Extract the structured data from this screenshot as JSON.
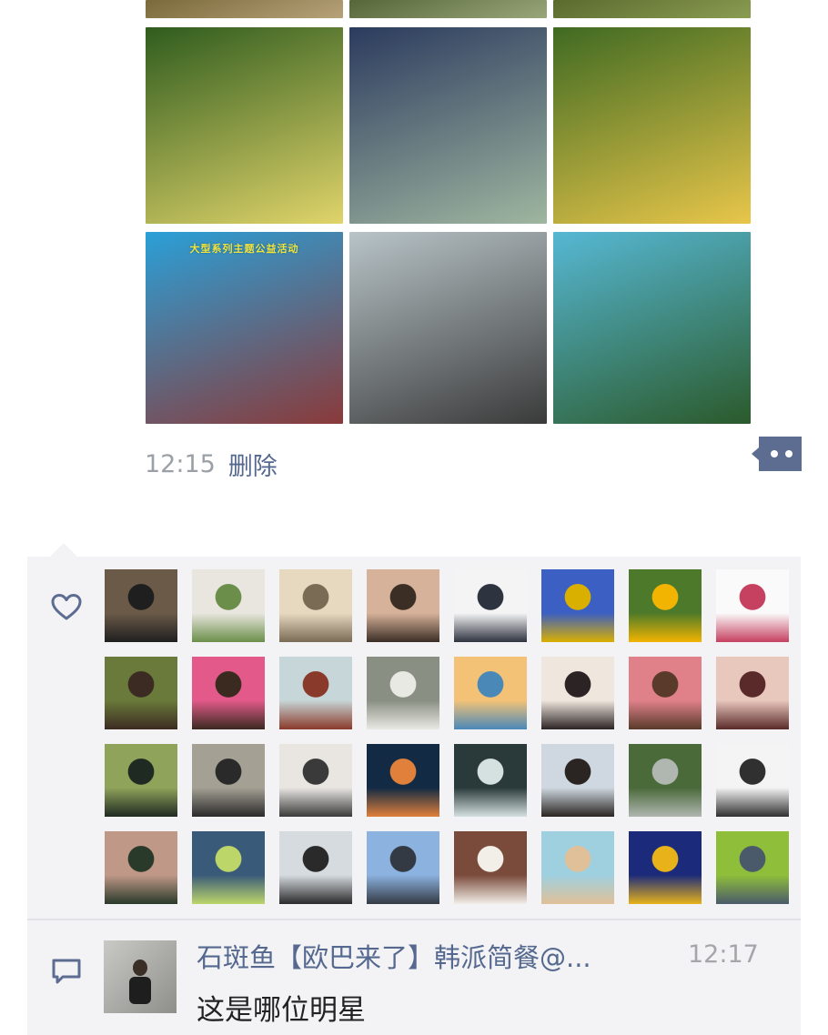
{
  "post": {
    "time": "12:15",
    "delete_label": "删除",
    "more_icon": "more-dots-icon",
    "photos": [
      {
        "name": "photo-top-1",
        "colors": [
          "#7a6a3a",
          "#b7a27a"
        ]
      },
      {
        "name": "photo-top-2",
        "colors": [
          "#556638",
          "#9aa67a"
        ]
      },
      {
        "name": "photo-top-3",
        "colors": [
          "#5a6a2e",
          "#8b9c52"
        ]
      },
      {
        "name": "photo-orchard-girl-fruit",
        "colors": [
          "#2f5c1e",
          "#e0d46a"
        ]
      },
      {
        "name": "photo-girl-blue-jacket",
        "colors": [
          "#2b3b5e",
          "#9fb6a0"
        ]
      },
      {
        "name": "photo-girl-picking-orange",
        "colors": [
          "#3f6a22",
          "#e8c64a"
        ]
      },
      {
        "name": "photo-event-stage",
        "caption": "大型系列主题公益活动",
        "colors": [
          "#2aa0d8",
          "#8a3a3a"
        ]
      },
      {
        "name": "photo-crowd",
        "colors": [
          "#b8c4c8",
          "#3a3a3a"
        ]
      },
      {
        "name": "photo-signboard",
        "colors": [
          "#56b8d4",
          "#2b5a2b"
        ]
      }
    ]
  },
  "likes": {
    "icon": "heart-icon",
    "avatars": [
      {
        "c": [
          "#6b5a48",
          "#1f1f1f"
        ]
      },
      {
        "c": [
          "#e9e6df",
          "#6b8f4a"
        ]
      },
      {
        "c": [
          "#e7d8c0",
          "#7a6b55"
        ]
      },
      {
        "c": [
          "#d7b29a",
          "#3b2e25"
        ]
      },
      {
        "c": [
          "#f4f4f4",
          "#2e3340"
        ]
      },
      {
        "c": [
          "#3b5fc2",
          "#d9b000"
        ]
      },
      {
        "c": [
          "#4d7a2a",
          "#f2b400"
        ]
      },
      {
        "c": [
          "#fafafa",
          "#c64060"
        ]
      },
      {
        "c": [
          "#6a7a3a",
          "#3c2b22"
        ]
      },
      {
        "c": [
          "#e35a8a",
          "#3a2a20"
        ]
      },
      {
        "c": [
          "#c7d6d8",
          "#8a3a2a"
        ]
      },
      {
        "c": [
          "#8a8f84",
          "#e9e9e4"
        ]
      },
      {
        "c": [
          "#f3c277",
          "#4a88b8"
        ]
      },
      {
        "c": [
          "#efe6dd",
          "#2c2424"
        ]
      },
      {
        "c": [
          "#e0818a",
          "#5a3a2a"
        ]
      },
      {
        "c": [
          "#e8c7bd",
          "#5a2a2a"
        ]
      },
      {
        "c": [
          "#8fa35a",
          "#1f2a22"
        ]
      },
      {
        "c": [
          "#a4a094",
          "#2a2a2a"
        ]
      },
      {
        "c": [
          "#e9e6e2",
          "#3a3a3a"
        ]
      },
      {
        "c": [
          "#122a44",
          "#e0803a"
        ]
      },
      {
        "c": [
          "#2a3a3a",
          "#d5e0e0"
        ]
      },
      {
        "c": [
          "#cfd8e0",
          "#2a2522"
        ]
      },
      {
        "c": [
          "#4a6a3a",
          "#b0b6b0"
        ]
      },
      {
        "c": [
          "#f4f4f4",
          "#303030"
        ]
      },
      {
        "c": [
          "#c09888",
          "#2a3a2a"
        ]
      },
      {
        "c": [
          "#3a5a7a",
          "#bcd66a"
        ]
      },
      {
        "c": [
          "#d6dbe0",
          "#2a2a2a"
        ]
      },
      {
        "c": [
          "#8cb2e0",
          "#333a44"
        ]
      },
      {
        "c": [
          "#7a4a3a",
          "#f2efe8"
        ]
      },
      {
        "c": [
          "#9fd0e0",
          "#e0c098"
        ]
      },
      {
        "c": [
          "#1b2a7a",
          "#e7b21a"
        ]
      },
      {
        "c": [
          "#8fbf3a",
          "#4a5a6a"
        ]
      }
    ]
  },
  "comment": {
    "icon": "comment-icon",
    "author": "石斑鱼【欧巴来了】韩派简餐@...",
    "time": "12:17",
    "text": "这是哪位明星"
  },
  "colors": {
    "link": "#55688f",
    "panel": "#f3f3f5"
  }
}
